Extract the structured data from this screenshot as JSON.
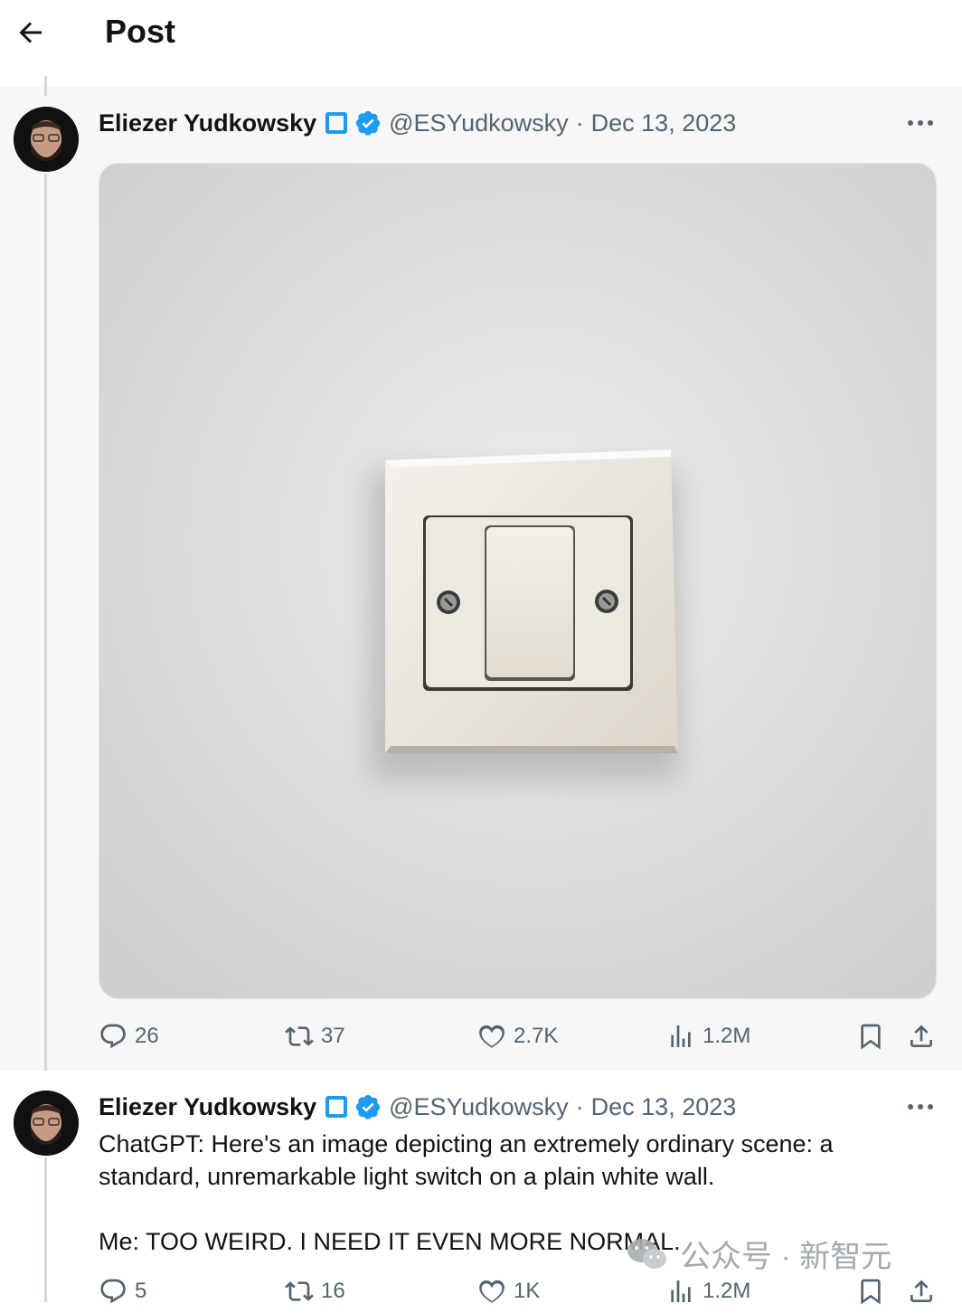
{
  "header": {
    "title": "Post"
  },
  "main_tweet": {
    "author": {
      "name": "Eliezer Yudkowsky",
      "handle": "@ESYudkowsky",
      "date": "Dec 13, 2023"
    },
    "stats": {
      "replies": "26",
      "reposts": "37",
      "likes": "2.7K",
      "views": "1.2M"
    }
  },
  "reply_tweet": {
    "author": {
      "name": "Eliezer Yudkowsky",
      "handle": "@ESYudkowsky",
      "date": "Dec 13, 2023"
    },
    "text_line1": "ChatGPT:  Here's an image depicting an extremely ordinary scene: a",
    "text_line2": "standard, unremarkable light switch on a plain white wall.",
    "text_line3": "Me:  TOO WEIRD.  I NEED IT EVEN MORE NORMAL.",
    "stats": {
      "replies": "5",
      "reposts": "16",
      "likes": "1K",
      "views": "1.2M"
    }
  },
  "watermark": {
    "text": "公众号 · 新智元"
  },
  "colors": {
    "accent": "#1d9bf0",
    "secondary_text": "#536471",
    "thread_line": "#cfd9de"
  },
  "icons": [
    "back-arrow-icon",
    "square-badge-icon",
    "verified-badge-icon",
    "more-icon",
    "reply-icon",
    "repost-icon",
    "like-icon",
    "views-icon",
    "bookmark-icon",
    "share-icon",
    "wechat-icon"
  ]
}
